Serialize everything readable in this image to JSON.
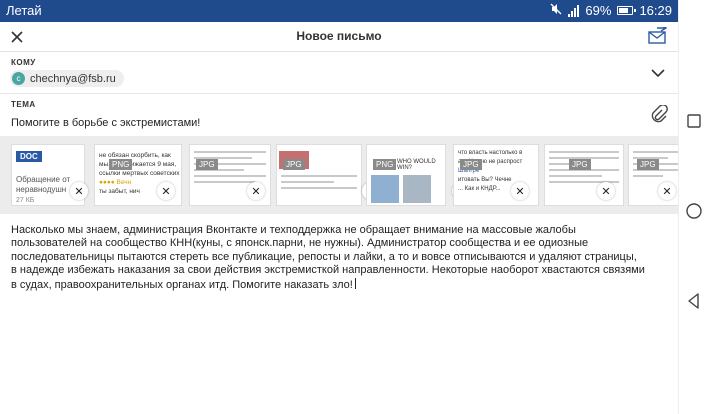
{
  "status_bar": {
    "carrier": "Летай",
    "battery": "69%",
    "time": "16:29",
    "icons": [
      "mute-icon",
      "signal-icon",
      "battery-icon"
    ]
  },
  "app_bar": {
    "title": "Новое письмо",
    "icons": [
      "close-icon",
      "send-icon"
    ]
  },
  "to_field": {
    "label": "КОМУ",
    "avatar_letter": "c",
    "recipient": "chechnya@fsb.ru",
    "expand_icon": "chevron-down-icon"
  },
  "subject_field": {
    "label": "ТЕМА",
    "value": "Помогите в борьбе с экстремистами!",
    "attach_icon": "paperclip-icon"
  },
  "attachments": [
    {
      "type": "DOC",
      "name": "Обращение от неравнодушн",
      "size": "27 КБ"
    },
    {
      "type": "PNG",
      "preview_text": [
        "не обязан скорбить, как",
        "мы. Приближается 9 мая,",
        "ссылки мертвых советских",
        "Вечн",
        "ты забыт, нич"
      ]
    },
    {
      "type": "JPG"
    },
    {
      "type": "JPG"
    },
    {
      "type": "PNG",
      "preview_text": [
        "WHO WOULD WIN?"
      ]
    },
    {
      "type": "JPG",
      "preview_text": [
        "Шалгре",
        "что власть настолько в",
        "итовать Вы? Чечне",
        "ато Чечню не распрост",
        "... Как и КНДР..."
      ]
    },
    {
      "type": "JPG"
    },
    {
      "type": "JPG"
    }
  ],
  "body": {
    "lines": [
      "Насколько мы знаем,  администрация Вконтакте и техподдержка не обращает внимание на массовые жалобы",
      "пользователей на сообщество КНН(куны,  с японск.парни,  не нужны). Администратор сообщества и ее одиозные",
      "последовательницы пытаются стереть все публикацие,  репосты и лайки,  а то и вовсе отписываются и удаляют страницы,",
      "в надежде избежать наказания за свои действия экстремисткой направленности. Некоторые наоборот хвастаются связями",
      "в судах,  правоохранительных органах итд. Помогите наказать зло!"
    ]
  },
  "nav_bar": {
    "icons": [
      "recents-square-icon",
      "home-circle-icon",
      "back-triangle-icon"
    ]
  },
  "colors": {
    "status_bar": "#1f4a8c",
    "accent": "#2a5aa5",
    "avatar": "#4aa6a0"
  }
}
